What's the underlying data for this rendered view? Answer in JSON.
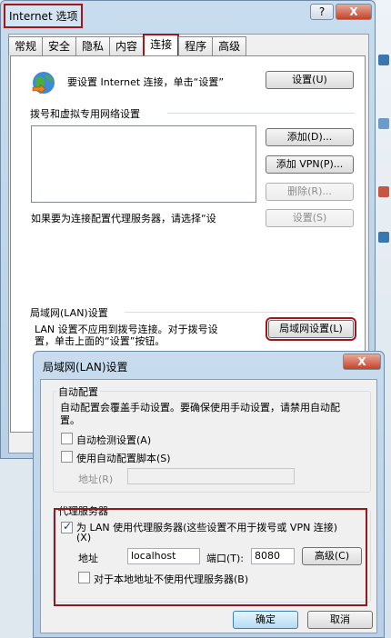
{
  "colors": {
    "highlight": "#a4161a",
    "primary_button": "#b5dcf3"
  },
  "main_window": {
    "title": "Internet 选项",
    "title_buttons": {
      "help": "?",
      "close": "X"
    },
    "tabs": [
      {
        "label": "常规"
      },
      {
        "label": "安全"
      },
      {
        "label": "隐私"
      },
      {
        "label": "内容"
      },
      {
        "label": "连接"
      },
      {
        "label": "程序"
      },
      {
        "label": "高级"
      }
    ],
    "setup_text": "要设置 Internet 连接，单击“设置”",
    "setup_button": "设置(U)",
    "dialup_section": "拨号和虚拟专用网络设置",
    "add_button": "添加(D)...",
    "add_vpn_button": "添加 VPN(P)...",
    "delete_button": "删除(R)...",
    "proxy_hint": "如果要为连接配置代理服务器，请选择“设",
    "settings_button": "设置(S)",
    "lan_section": "局域网(LAN)设置",
    "lan_desc_1": "LAN 设置不应用到拨号连接。对于拨号设",
    "lan_desc_2": "置，单击上面的“设置”按钮。",
    "lan_button": "局域网设置(L)"
  },
  "lan_dialog": {
    "title": "局域网(LAN)设置",
    "close": "X",
    "auto_config": {
      "group": "自动配置",
      "desc_1": "自动配置会覆盖手动设置。要确保使用手动设置，请禁用自动配",
      "desc_2": "置。",
      "auto_detect": "自动检测设置(A)",
      "auto_script": "使用自动配置脚本(S)",
      "address_label": "地址(R)",
      "address_value": ""
    },
    "proxy": {
      "group": "代理服务器",
      "use_proxy_1": "为 LAN 使用代理服务器(这些设置不用于拨号或 VPN 连接)",
      "use_proxy_2": "(X)",
      "use_proxy_checked": true,
      "address_label": "地址",
      "address_value": "localhost",
      "port_label": "端口(T):",
      "port_value": "8080",
      "advanced_button": "高级(C)",
      "bypass_local": "对于本地地址不使用代理服务器(B)",
      "bypass_local_checked": false
    },
    "ok_button": "确定",
    "cancel_button": "取消"
  }
}
